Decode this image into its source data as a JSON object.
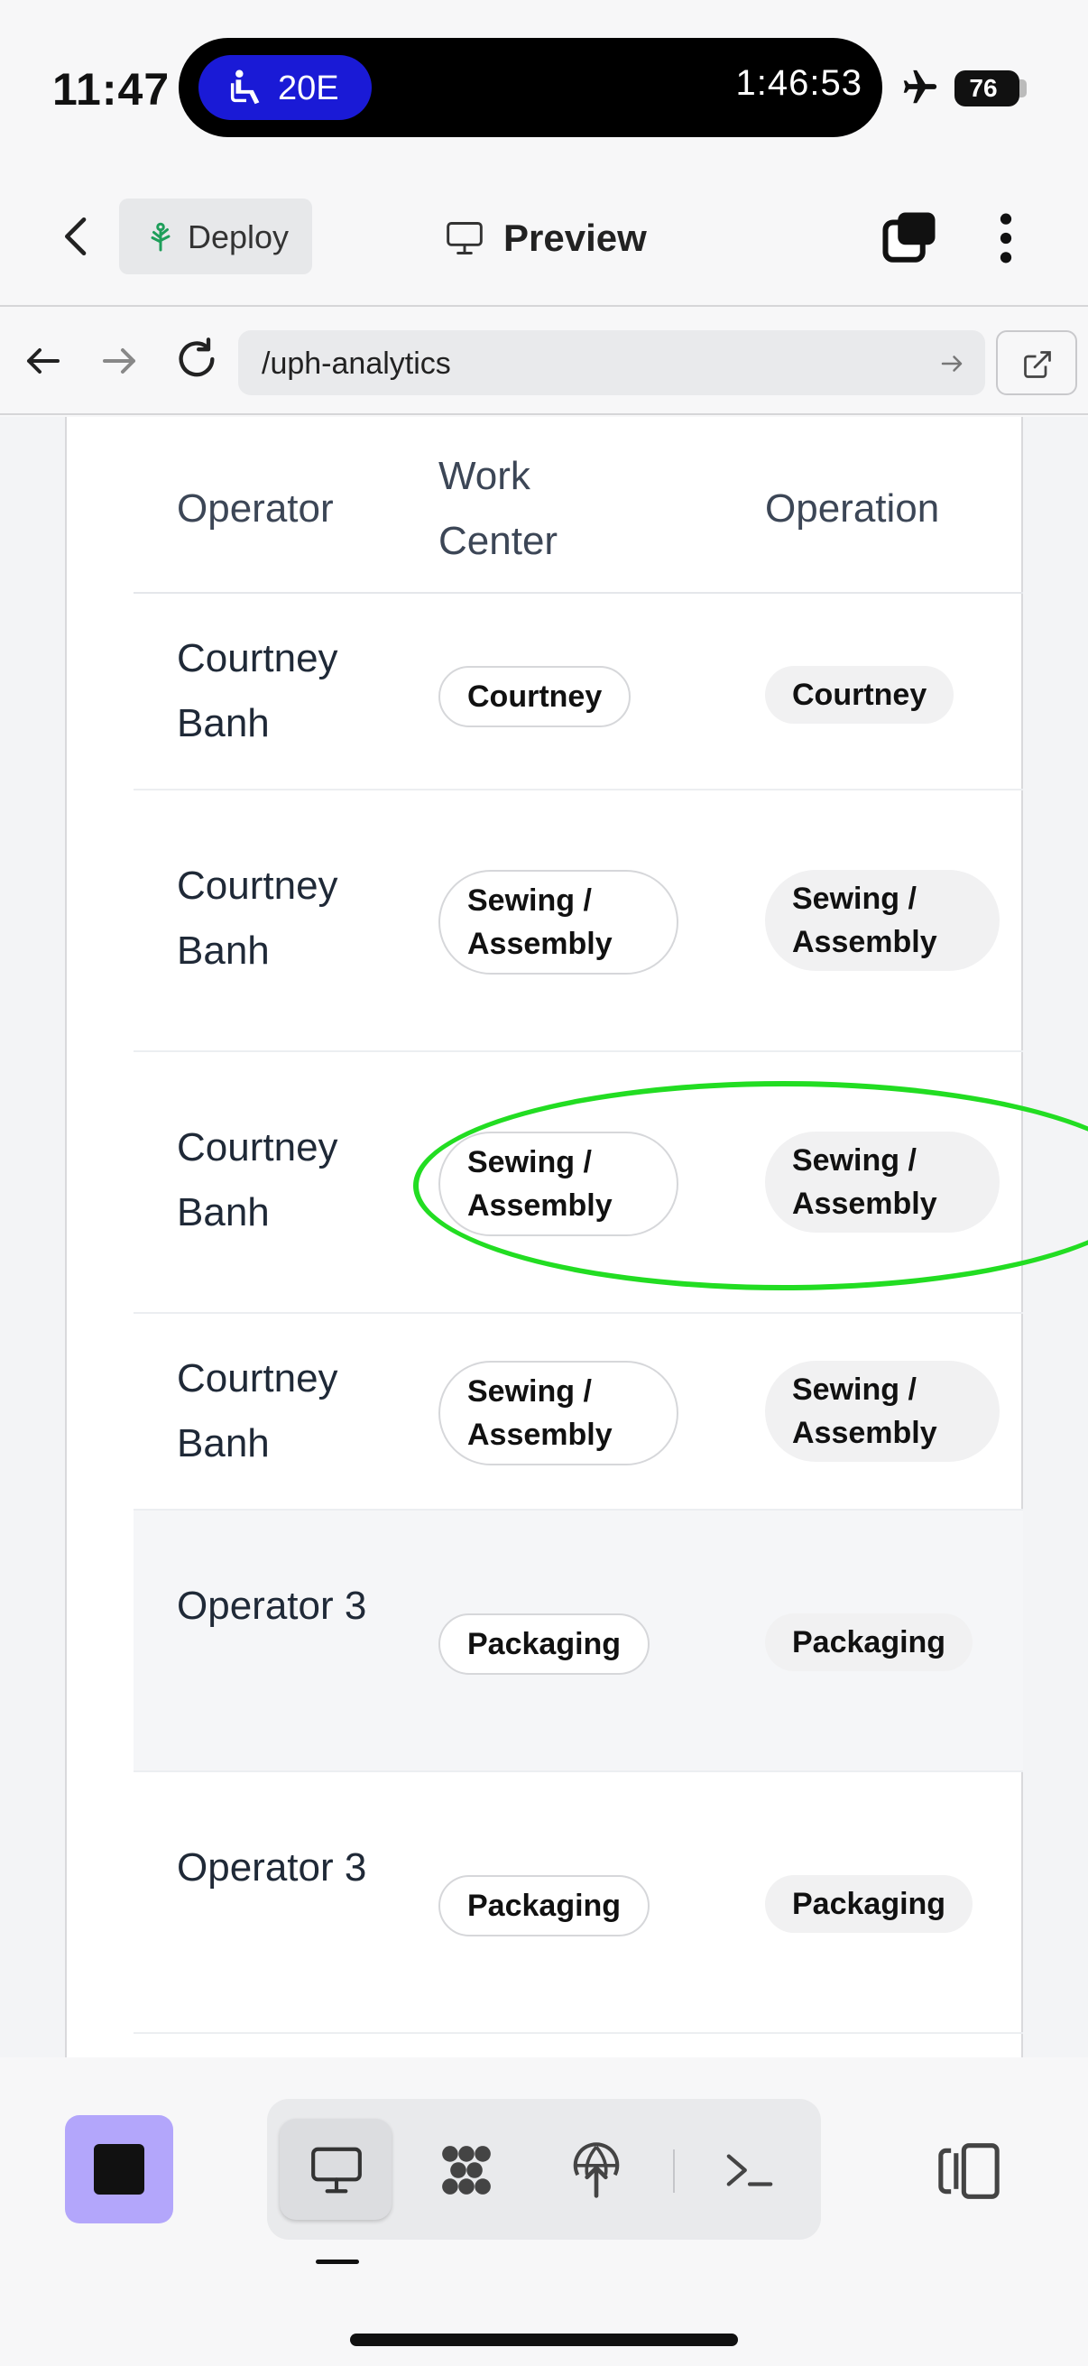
{
  "status_bar": {
    "time": "11:47",
    "seat": "20E",
    "timer": "1:46:53",
    "battery": "76"
  },
  "app_bar": {
    "deploy_label": "Deploy",
    "title": "Preview"
  },
  "browser": {
    "url": "/uph-analytics"
  },
  "table": {
    "headers": {
      "operator": "Operator",
      "work_center": "Work Center",
      "operation": "Operation"
    },
    "rows": [
      {
        "operator": "Courtney Banh",
        "work_center": "Courtney",
        "operation": "Courtney"
      },
      {
        "operator": "Courtney Banh",
        "work_center": "Sewing / Assembly",
        "operation": "Sewing / Assembly"
      },
      {
        "operator": "Courtney Banh",
        "work_center": "Sewing / Assembly",
        "operation": "Sewing / Assembly"
      },
      {
        "operator": "Courtney Banh",
        "work_center": "Sewing / Assembly",
        "operation": "Sewing / Assembly"
      },
      {
        "operator": "Operator 3",
        "work_center": "Packaging",
        "operation": "Packaging"
      },
      {
        "operator": "Operator 3",
        "work_center": "Packaging",
        "operation": "Packaging"
      }
    ]
  },
  "colors": {
    "highlight": "#22dd22",
    "stop_button": "#b3a6fb",
    "seat_pill": "#1a1ad6"
  }
}
